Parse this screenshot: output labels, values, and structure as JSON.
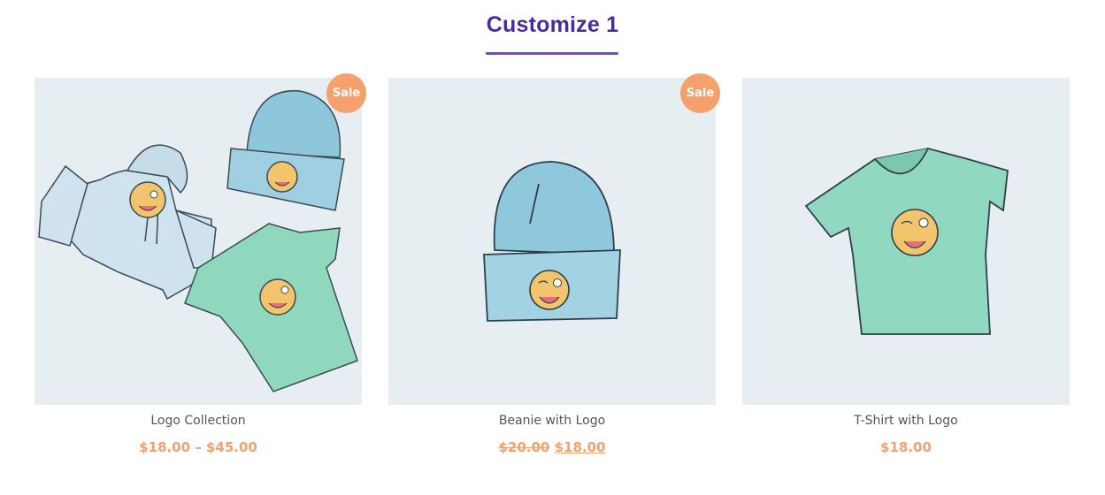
{
  "section": {
    "title": "Customize 1"
  },
  "colors": {
    "title": "#4a2aa0",
    "underline": "#7a48c4",
    "badge": "#f6a06c",
    "price": "#f4a06e",
    "image_bg": "#e7eef2"
  },
  "products": [
    {
      "name": "Logo Collection",
      "badge": "Sale",
      "price_range": "$18.00 – $45.00",
      "image_icon": "hoodie-beanie-tshirt-illustration"
    },
    {
      "name": "Beanie with Logo",
      "badge": "Sale",
      "old_price": "$20.00",
      "new_price": "$18.00",
      "image_icon": "beanie-illustration"
    },
    {
      "name": "T-Shirt with Logo",
      "price": "$18.00",
      "image_icon": "tshirt-illustration"
    }
  ]
}
